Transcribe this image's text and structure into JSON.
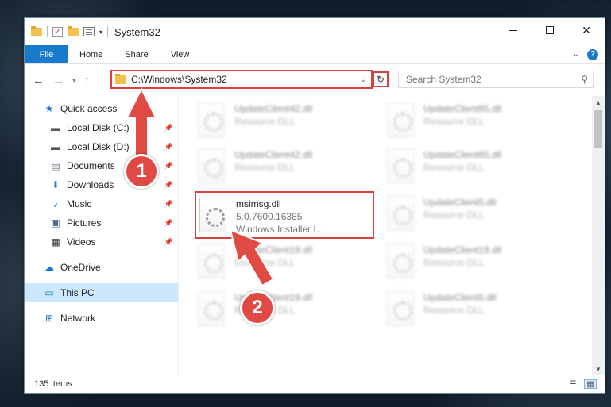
{
  "window": {
    "title": "System32",
    "controls": {
      "minimize": "—",
      "maximize": "☐",
      "close": "✕"
    }
  },
  "ribbon": {
    "file": "File",
    "tabs": [
      "Home",
      "Share",
      "View"
    ],
    "help": "?"
  },
  "address": {
    "path": "C:\\Windows\\System32",
    "search_placeholder": "Search System32"
  },
  "sidebar": {
    "items": [
      {
        "label": "Quick access",
        "icon": "star-icon"
      },
      {
        "label": "Local Disk (C:)",
        "icon": "drive-icon"
      },
      {
        "label": "Local Disk (D:)",
        "icon": "drive-icon"
      },
      {
        "label": "Documents",
        "icon": "documents-icon"
      },
      {
        "label": "Downloads",
        "icon": "download-icon"
      },
      {
        "label": "Music",
        "icon": "music-icon"
      },
      {
        "label": "Pictures",
        "icon": "pictures-icon"
      },
      {
        "label": "Videos",
        "icon": "videos-icon"
      },
      {
        "label": "OneDrive",
        "icon": "cloud-icon"
      },
      {
        "label": "This PC",
        "icon": "pc-icon"
      },
      {
        "label": "Network",
        "icon": "network-icon"
      }
    ]
  },
  "files": {
    "left": [
      {
        "name": "UpdateClient42.dll",
        "sub": "Resource DLL"
      },
      {
        "name": "UpdateClient42.dll",
        "sub": "Resource DLL"
      },
      {
        "name": "msimsg.dll",
        "version": "5.0.7600.16385",
        "desc": "Windows Installer I..."
      },
      {
        "name": "UpdateClient19.dll",
        "sub": "Resource DLL"
      },
      {
        "name": "UpdateClient19.dll",
        "sub": "Resource DLL"
      }
    ],
    "right": [
      {
        "name": "UpdateClient65.dll",
        "sub": "Resource DLL"
      },
      {
        "name": "UpdateClient65.dll",
        "sub": "Resource DLL"
      },
      {
        "name": "UpdateClient5.dll",
        "sub": "Resource DLL"
      },
      {
        "name": "UpdateClient19.dll",
        "sub": "Resource DLL"
      },
      {
        "name": "UpdateClient5.dll",
        "sub": "Resource DLL"
      }
    ]
  },
  "status": {
    "count": "135 items"
  },
  "callouts": {
    "one": "1",
    "two": "2"
  },
  "colors": {
    "accent": "#1979ca",
    "highlight": "#d9413c",
    "selected": "#cce8ff"
  }
}
